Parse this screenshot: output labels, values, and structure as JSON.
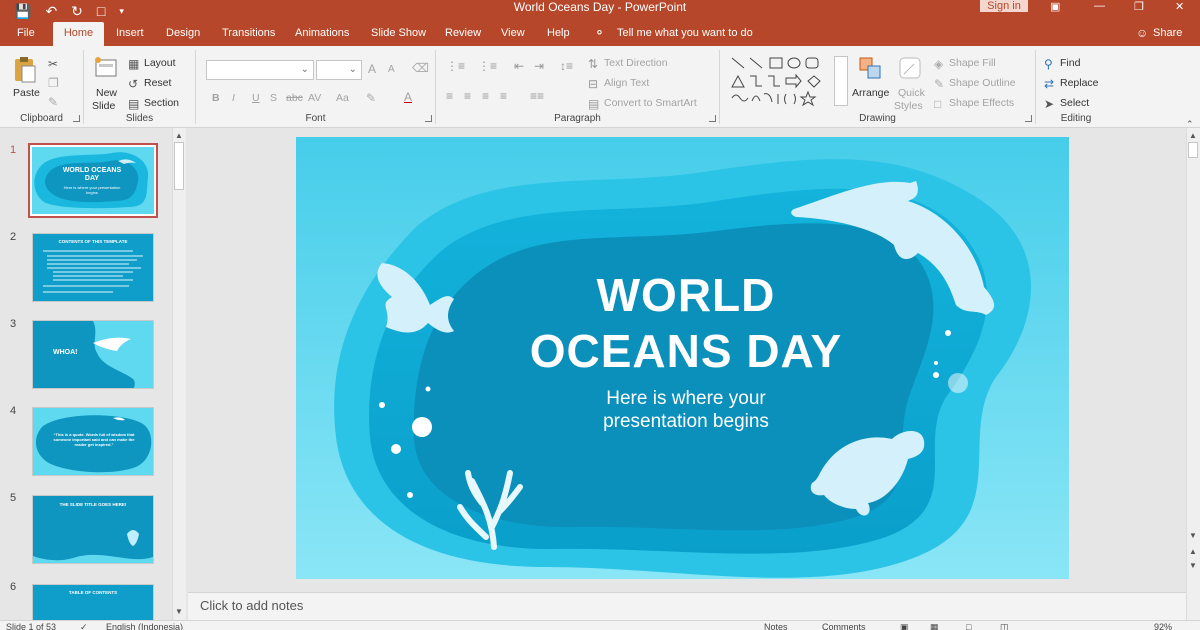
{
  "window": {
    "title": "World Oceans Day  -  PowerPoint",
    "signin_label": "Sign in",
    "share_label": "Share"
  },
  "tabs": [
    "File",
    "Home",
    "Insert",
    "Design",
    "Transitions",
    "Animations",
    "Slide Show",
    "Review",
    "View",
    "Help"
  ],
  "tell_me": "Tell me what you want to do",
  "ribbon": {
    "clipboard": {
      "paste": "Paste",
      "group": "Clipboard"
    },
    "slides": {
      "new_slide_1": "New",
      "new_slide_2": "Slide",
      "layout": "Layout",
      "reset": "Reset",
      "section": "Section",
      "group": "Slides"
    },
    "font": {
      "bold": "B",
      "italic": "I",
      "underline": "U",
      "shadow": "S",
      "strike": "abc",
      "spacing": "AV",
      "case": "Aa",
      "grow": "A",
      "shrink": "A",
      "color": "A",
      "group": "Font"
    },
    "paragraph": {
      "text_direction": "Text Direction",
      "align_text": "Align Text",
      "convert": "Convert to SmartArt",
      "group": "Paragraph"
    },
    "drawing": {
      "arrange": "Arrange",
      "quick_styles_1": "Quick",
      "quick_styles_2": "Styles",
      "shape_fill": "Shape Fill",
      "shape_outline": "Shape Outline",
      "shape_effects": "Shape Effects",
      "group": "Drawing"
    },
    "editing": {
      "find": "Find",
      "replace": "Replace",
      "select": "Select",
      "group": "Editing"
    }
  },
  "thumbnails": [
    {
      "num": "1",
      "title": "WORLD OCEANS DAY",
      "sub": "Here is where your presentation begins"
    },
    {
      "num": "2",
      "title": "CONTENTS OF THIS TEMPLATE"
    },
    {
      "num": "3",
      "title": "WHOA!"
    },
    {
      "num": "4",
      "title": "“This is a quote. Words full of wisdom that someone important said and can make the reader get inspired.”"
    },
    {
      "num": "5",
      "title": "THE SLIDE TITLE GOES HERE!"
    },
    {
      "num": "6",
      "title": "TABLE OF CONTENTS"
    }
  ],
  "slide": {
    "title_line1": "WORLD",
    "title_line2": "OCEANS DAY",
    "subtitle_line1": "Here is where your",
    "subtitle_line2": "presentation begins"
  },
  "notes_placeholder": "Click to add notes",
  "status": {
    "slide_counter": "Slide 1 of 53",
    "language": "English (Indonesia)",
    "notes": "Notes",
    "comments": "Comments",
    "zoom": "92%"
  },
  "colors": {
    "accent": "#b7472a",
    "ocean_light": "#5fd9f0",
    "ocean_mid": "#0fb3d9",
    "ocean_deep": "#0a8fb6"
  }
}
